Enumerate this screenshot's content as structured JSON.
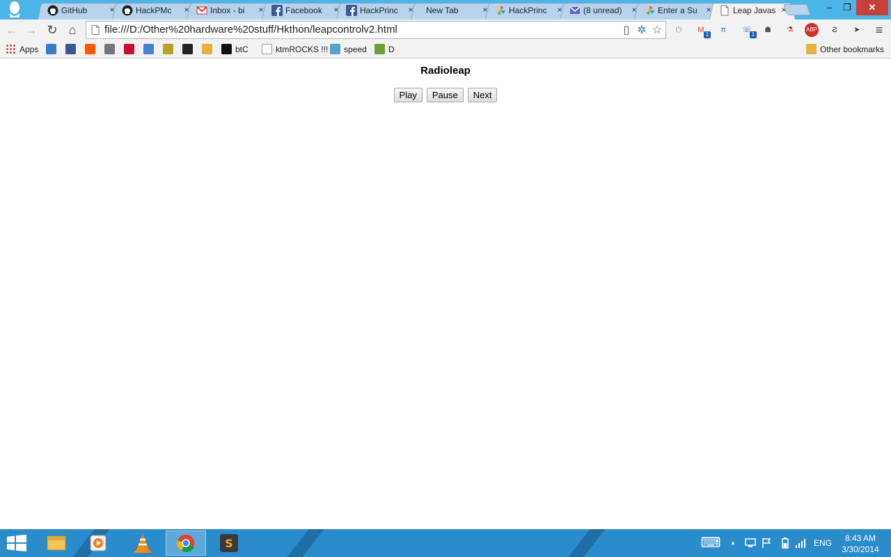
{
  "browser": {
    "tabs": [
      {
        "title": "GitHub",
        "icon": "github-icon",
        "active": false
      },
      {
        "title": "HackPMc",
        "icon": "github-icon",
        "active": false
      },
      {
        "title": "Inbox - bi",
        "icon": "gmail-icon",
        "active": false
      },
      {
        "title": "Facebook",
        "icon": "facebook-icon",
        "active": false
      },
      {
        "title": "HackPrinc",
        "icon": "facebook-icon",
        "active": false
      },
      {
        "title": "New Tab",
        "icon": "",
        "active": false
      },
      {
        "title": "HackPrinc",
        "icon": "pinwheel-icon",
        "active": false
      },
      {
        "title": "(8 unread)",
        "icon": "mail-icon",
        "active": false
      },
      {
        "title": "Enter a Su",
        "icon": "pinwheel-icon",
        "active": false
      },
      {
        "title": "Leap Javas",
        "icon": "page-icon",
        "active": true
      }
    ],
    "tab_close_glyph": "×",
    "window_controls": {
      "minimize": "–",
      "maximize": "❐",
      "close": "✕"
    },
    "nav": {
      "back": "←",
      "forward": "→",
      "reload": "↻",
      "home": "⌂"
    },
    "address_bar": {
      "url": "file:///D:/Other%20hardware%20stuff/Hkthon/leapcontrolv2.html"
    },
    "omnibox_icons": {
      "page_action": "▯",
      "extension": "✲",
      "star": "☆"
    },
    "extensions": [
      {
        "name": "power-extension-icon",
        "glyph": "⏻",
        "color": "#8a8a8a",
        "badge": ""
      },
      {
        "name": "gmail-checker-icon",
        "glyph": "M",
        "color": "#d23c2f",
        "badge": "1"
      },
      {
        "name": "pi-extension-icon",
        "glyph": "π",
        "color": "#3b6fb0",
        "badge": ""
      },
      {
        "name": "chat-extension-icon",
        "glyph": "☏",
        "color": "#2f6cc0",
        "badge": "1"
      },
      {
        "name": "ghost-extension-icon",
        "glyph": "☗",
        "color": "#555555",
        "badge": ""
      },
      {
        "name": "joint-extension-icon",
        "glyph": "⚗",
        "color": "#c0392b",
        "badge": ""
      },
      {
        "name": "adblock-icon",
        "glyph": "ABP",
        "color": "#d42a2a",
        "badge": ""
      },
      {
        "name": "hook-extension-icon",
        "glyph": "Ƨ",
        "color": "#222222",
        "badge": ""
      },
      {
        "name": "cursor-off-extension-icon",
        "glyph": "➤",
        "color": "#333333",
        "badge": ""
      },
      {
        "name": "chrome-menu-icon",
        "glyph": "≡",
        "color": "#444444",
        "badge": ""
      }
    ],
    "bookmarks": [
      {
        "label": "Apps",
        "icon": "apps-grid-icon",
        "color": "#d44"
      },
      {
        "label": "",
        "icon": "translate-icon",
        "color": "#3a79c8"
      },
      {
        "label": "",
        "icon": "facebook-icon",
        "color": "#3b5998"
      },
      {
        "label": "",
        "icon": "reddit-icon",
        "color": "#ff5700"
      },
      {
        "label": "",
        "icon": "image-icon",
        "color": "#777"
      },
      {
        "label": "",
        "icon": "shield-crest-icon",
        "color": "#c8102e"
      },
      {
        "label": "",
        "icon": "calendar-icon",
        "color": "#4a7fd8"
      },
      {
        "label": "",
        "icon": "globe-icon",
        "color": "#b8a423"
      },
      {
        "label": "",
        "icon": "soccer-ball-icon",
        "color": "#222"
      },
      {
        "label": "",
        "icon": "folder-icon",
        "color": "#e2b33e"
      },
      {
        "label": "btC",
        "icon": "btc-icon",
        "color": "#111"
      },
      {
        "label": "ktmROCKS !!!",
        "icon": "page-icon",
        "color": "#999"
      },
      {
        "label": "speed",
        "icon": "cloud-icon",
        "color": "#5aa0c8"
      },
      {
        "label": "D",
        "icon": "game-controller-icon",
        "color": "#6aa234"
      }
    ],
    "other_bookmarks": "Other bookmarks"
  },
  "page": {
    "title": "Radioleap",
    "buttons": {
      "play": "Play",
      "pause": "Pause",
      "next": "Next"
    }
  },
  "taskbar": {
    "apps": [
      {
        "name": "file-explorer-icon",
        "active": false
      },
      {
        "name": "media-player-icon",
        "active": false
      },
      {
        "name": "vlc-icon",
        "active": false
      },
      {
        "name": "chrome-icon",
        "active": true
      },
      {
        "name": "sublime-text-icon",
        "active": false
      }
    ],
    "tray": {
      "keyboard": "⌨",
      "show_hidden": "▲",
      "language": "ENG"
    },
    "clock": {
      "time": "8:43 AM",
      "date": "3/30/2014"
    }
  }
}
